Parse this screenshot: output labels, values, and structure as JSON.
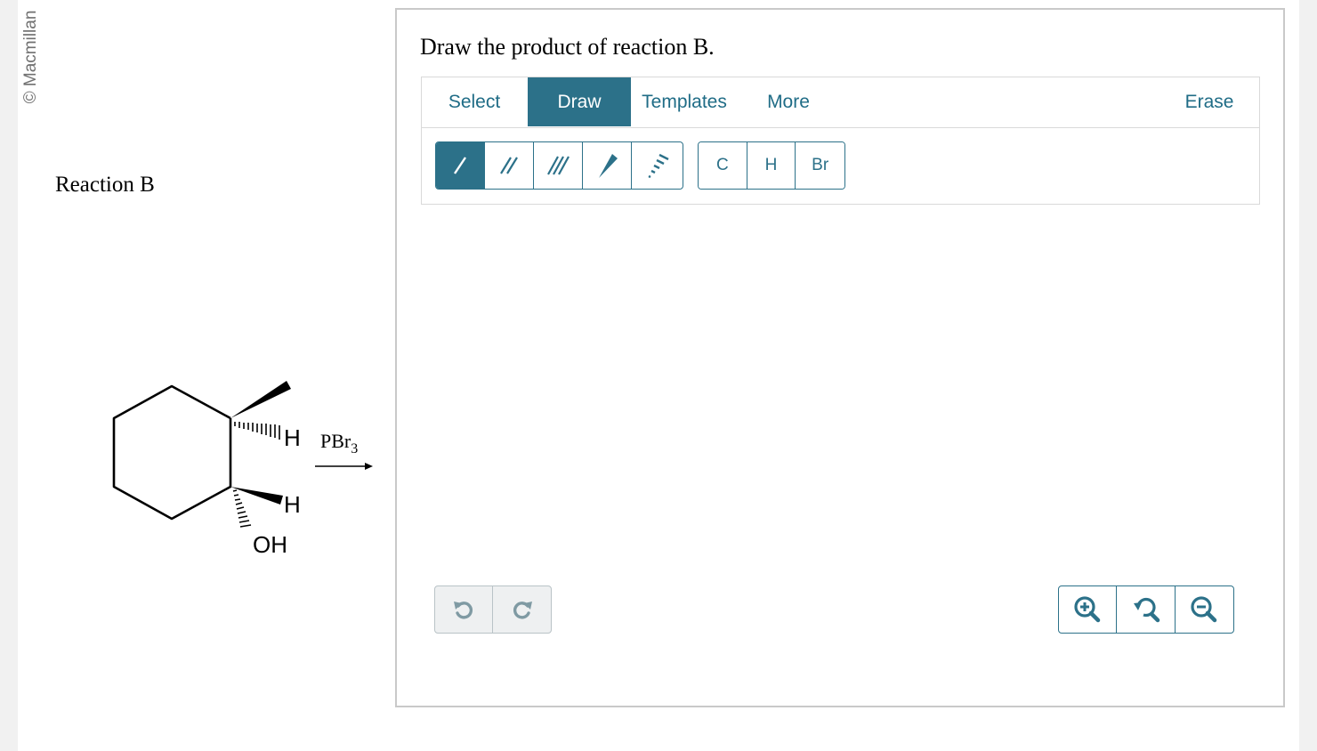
{
  "copyright": "© Macmillan",
  "reaction": {
    "title": "Reaction B",
    "labels": {
      "h_top": "H",
      "h_bottom": "H",
      "oh": "OH",
      "reagent_main": "PBr",
      "reagent_sub": "3"
    }
  },
  "question": {
    "text": "Draw the product of reaction B."
  },
  "editor": {
    "tabs": {
      "select": "Select",
      "draw": "Draw",
      "templates": "Templates",
      "more": "More",
      "erase": "Erase"
    },
    "active_tab": "Draw",
    "bond_tools": [
      "single-bond",
      "double-bond",
      "triple-bond",
      "wedge-bond",
      "hashed-wedge-bond"
    ],
    "active_bond_tool": "single-bond",
    "atoms": {
      "c": "C",
      "h": "H",
      "br": "Br"
    },
    "history_buttons": [
      "undo-icon",
      "redo-icon"
    ],
    "zoom_buttons": [
      "zoom-in-icon",
      "reset-zoom-icon",
      "zoom-out-icon"
    ],
    "accent_color": "#2c7189"
  }
}
